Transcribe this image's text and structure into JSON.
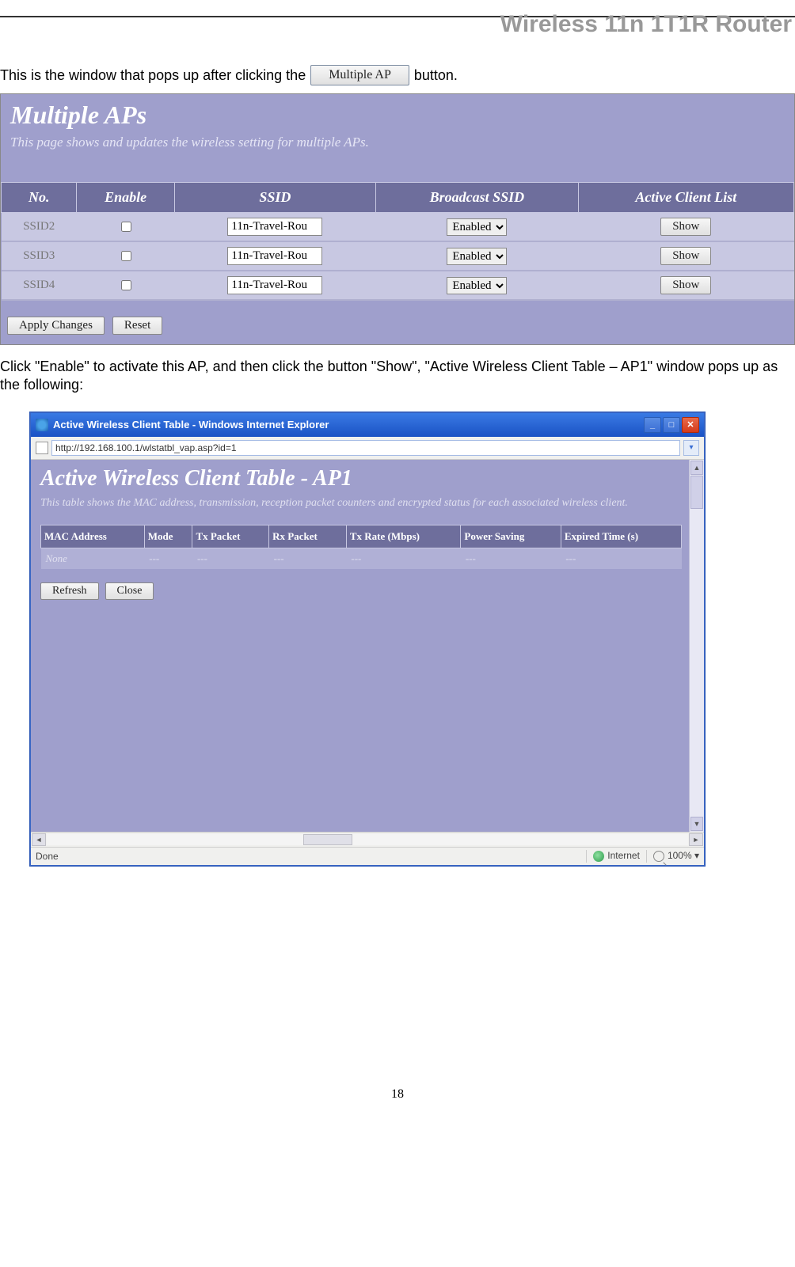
{
  "header": {
    "title": "Wireless 11n 1T1R Router"
  },
  "intro": {
    "before": "This is the window that pops up after clicking the",
    "btn": "Multiple AP",
    "after": " button."
  },
  "shot1": {
    "title": "Multiple APs",
    "desc": "This page shows and updates the wireless setting for multiple APs.",
    "headers": [
      "No.",
      "Enable",
      "SSID",
      "Broadcast SSID",
      "Active Client List"
    ],
    "rows": [
      {
        "no": "SSID2",
        "ssid": "11n-Travel-Rou",
        "bcast": "Enabled",
        "show": "Show"
      },
      {
        "no": "SSID3",
        "ssid": "11n-Travel-Rou",
        "bcast": "Enabled",
        "show": "Show"
      },
      {
        "no": "SSID4",
        "ssid": "11n-Travel-Rou",
        "bcast": "Enabled",
        "show": "Show"
      }
    ],
    "apply": "Apply Changes",
    "reset": "Reset"
  },
  "para2": "Click \"Enable\" to activate this AP, and then click the button \"Show\", \"Active Wireless Client Table – AP1\" window pops up as the following:",
  "iewin": {
    "title": "Active Wireless Client Table - Windows Internet Explorer",
    "url": "http://192.168.100.1/wlstatbl_vap.asp?id=1",
    "pagetitle": "Active Wireless Client Table - AP1",
    "pagedesc": "This table shows the MAC address, transmission, reception packet counters and encrypted status for each associated wireless client.",
    "headers": [
      "MAC Address",
      "Mode",
      "Tx Packet",
      "Rx Packet",
      "Tx Rate (Mbps)",
      "Power Saving",
      "Expired Time (s)"
    ],
    "row": [
      "None",
      "---",
      "---",
      "---",
      "---",
      "---",
      "---"
    ],
    "refresh": "Refresh",
    "close": "Close",
    "status_done": "Done",
    "status_zone": "Internet",
    "status_zoom": "100%"
  },
  "pagenum": "18"
}
